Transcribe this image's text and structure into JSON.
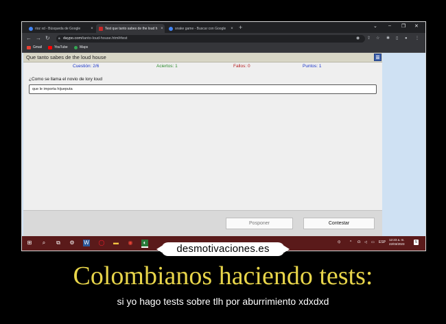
{
  "browser": {
    "tabs": [
      {
        "title": "rioz xd - Búsqueda de Google",
        "favicon_color": "#4285f4",
        "active": false
      },
      {
        "title": "Test que tanto sabes de the loud h",
        "favicon_color": "#c62828",
        "active": true
      },
      {
        "title": "snake game - Buscar con Google",
        "favicon_color": "#4285f4",
        "active": false
      }
    ],
    "new_tab_icon": "plus-icon",
    "address": {
      "host": "daypo.com",
      "path": "/tanto-loud-house.html#test"
    },
    "bookmarks": [
      {
        "label": "Gmail",
        "icon_color": "#ea4335"
      },
      {
        "label": "YouTube",
        "icon_color": "#ff0000"
      },
      {
        "label": "Maps",
        "icon_color": "#34a853"
      }
    ]
  },
  "quiz": {
    "title": "Que tanto sabes de the loud house",
    "stats": {
      "question_label": "Cuestión:",
      "question_value": "2/6",
      "correct_label": "Aciertos:",
      "correct_value": "1",
      "wrong_label": "Fallos:",
      "wrong_value": "0",
      "points_label": "Puntos:",
      "points_value": "1"
    },
    "question": "¿Como se llama el novio de lory loud",
    "answer_value": "que le importa hijueputa",
    "postpone_label": "Posponer",
    "answer_label": "Contestar",
    "colors": {
      "question": "#1a35c9",
      "correct": "#2a8a2a",
      "wrong": "#b51c1c",
      "points": "#1a35c9"
    }
  },
  "taskbar": {
    "clock_time": "12:23 a. m.",
    "clock_date": "22/03/2023",
    "lang": "ESP",
    "notifications": "5"
  },
  "poster": {
    "site": "desmotivaciones.es",
    "title": "Colombianos haciendo tests:",
    "subtitle": "si yo hago tests sobre tlh por aburrimiento xdxdxd"
  }
}
